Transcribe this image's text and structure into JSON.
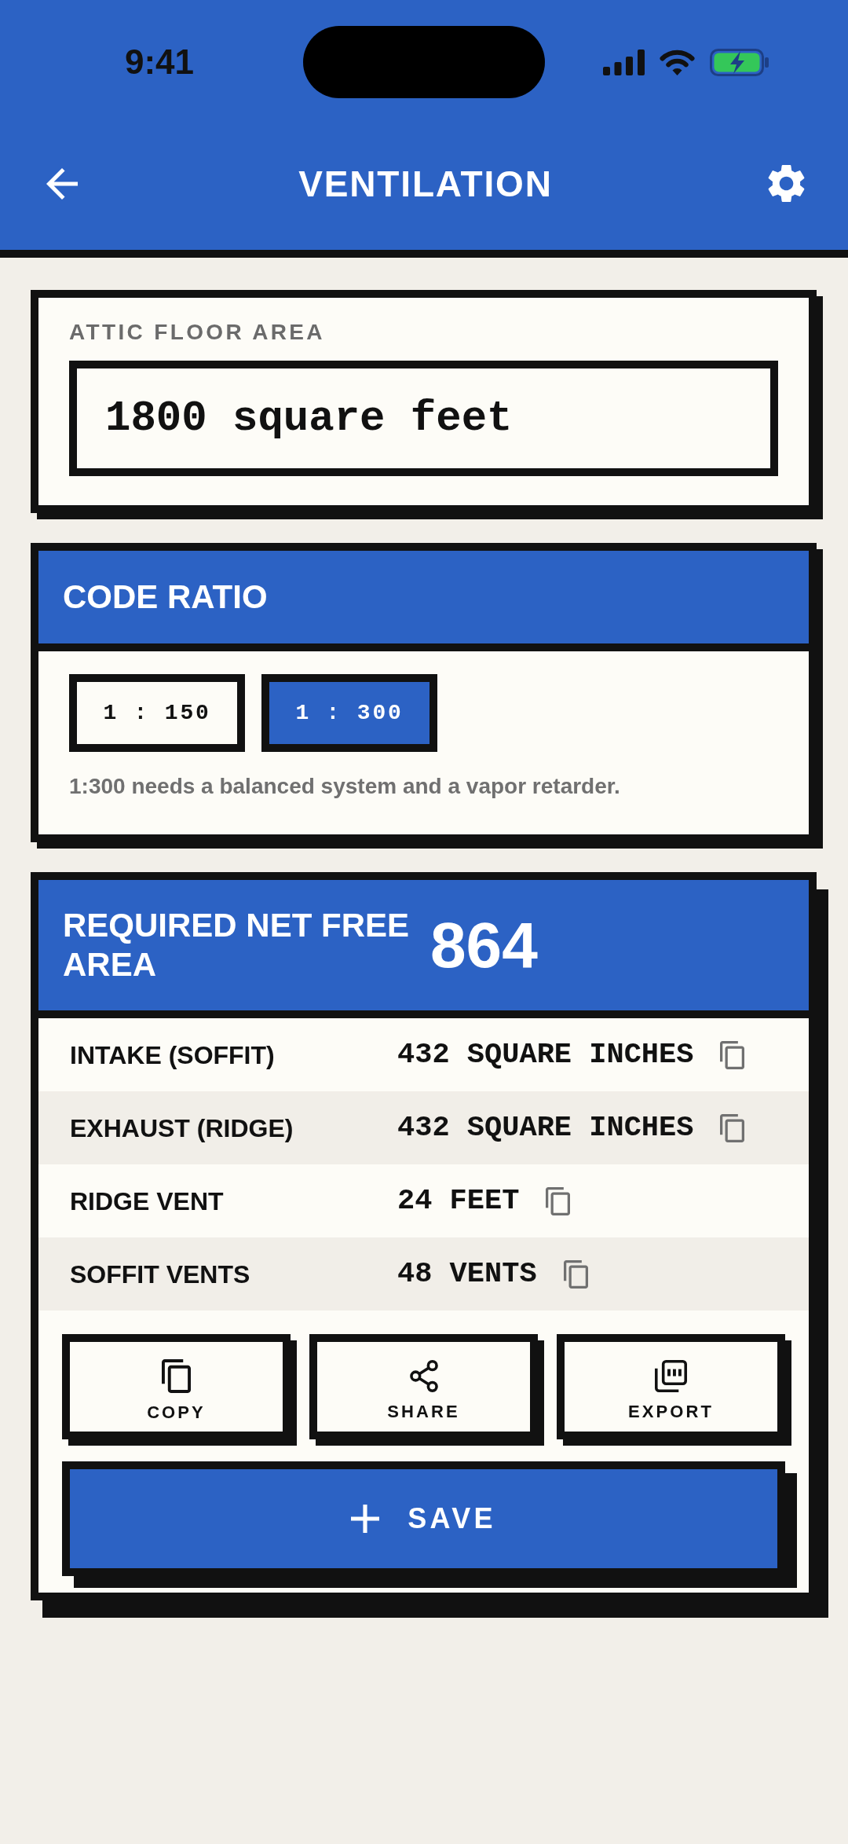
{
  "status_bar": {
    "time": "9:41"
  },
  "nav": {
    "title": "VENTILATION"
  },
  "attic_floor_area": {
    "label": "ATTIC FLOOR AREA",
    "value": "1800 square feet"
  },
  "code_ratio": {
    "title": "CODE RATIO",
    "options": [
      {
        "label": "1 : 150",
        "selected": false
      },
      {
        "label": "1 : 300",
        "selected": true
      }
    ],
    "note": "1:300 needs a balanced system and a vapor retarder."
  },
  "result": {
    "title": "REQUIRED NET FREE AREA",
    "value": "864",
    "rows": [
      {
        "label": "INTAKE (SOFFIT)",
        "value": "432 SQUARE INCHES"
      },
      {
        "label": "EXHAUST (RIDGE)",
        "value": "432 SQUARE INCHES"
      },
      {
        "label": "RIDGE VENT",
        "value": "24 FEET"
      },
      {
        "label": "SOFFIT VENTS",
        "value": "48 VENTS"
      }
    ],
    "actions": [
      {
        "kind": "copy",
        "label": "COPY"
      },
      {
        "kind": "share",
        "label": "SHARE"
      },
      {
        "kind": "export",
        "label": "EXPORT"
      }
    ],
    "save_button": {
      "label": "SAVE"
    }
  }
}
